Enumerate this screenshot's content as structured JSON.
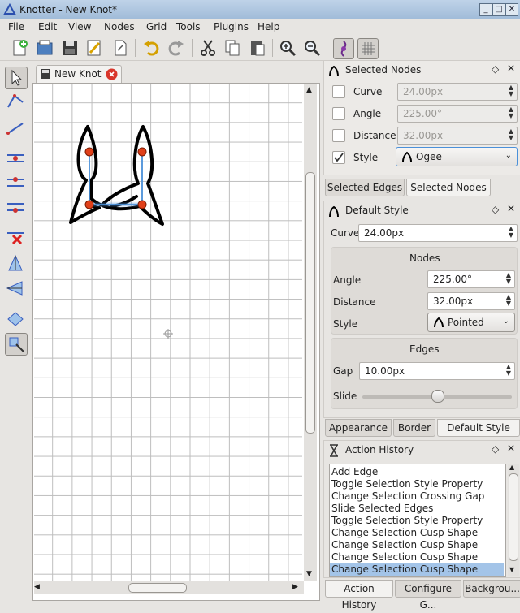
{
  "window": {
    "title": "Knotter - New Knot*"
  },
  "menu": [
    "File",
    "Edit",
    "View",
    "Nodes",
    "Grid",
    "Tools",
    "Plugins",
    "Help"
  ],
  "toolbar_icons": [
    "new-file-icon",
    "open-icon",
    "save-icon",
    "edit-icon",
    "export-icon",
    "undo-icon",
    "redo-icon",
    "cut-icon",
    "copy-icon",
    "paste-icon",
    "zoom-in-icon",
    "zoom-out-icon",
    "knot-view-icon",
    "grid-icon"
  ],
  "left_tools": [
    "select-pointer-icon",
    "edge-chain-icon",
    "edge-line-icon",
    "insert-edge-node-icon",
    "insert-node-icon",
    "link-nodes-icon",
    "delete-icon",
    "flip-vertical-icon",
    "flip-horizontal-icon",
    "merge-icon",
    "scale-icon"
  ],
  "document_tab": {
    "label": "New Knot"
  },
  "selected_nodes": {
    "title": "Selected Nodes",
    "rows": [
      {
        "label": "Curve",
        "value": "24.00px",
        "checked": false
      },
      {
        "label": "Angle",
        "value": "225.00°",
        "checked": false
      },
      {
        "label": "Distance",
        "value": "32.00px",
        "checked": false
      },
      {
        "label": "Style",
        "value": "Ogee",
        "checked": true
      }
    ]
  },
  "edge_tabs": [
    "Selected Edges",
    "Selected Nodes"
  ],
  "default_style": {
    "title": "Default Style",
    "curve_label": "Curve",
    "curve_value": "24.00px",
    "nodes_group": "Nodes",
    "angle_label": "Angle",
    "angle_value": "225.00°",
    "distance_label": "Distance",
    "distance_value": "32.00px",
    "style_label": "Style",
    "style_value": "Pointed",
    "edges_group": "Edges",
    "gap_label": "Gap",
    "gap_value": "10.00px",
    "slide_label": "Slide",
    "slide_fraction": 0.5
  },
  "style_tabs": [
    "Appearance",
    "Border",
    "Default Style"
  ],
  "action_history": {
    "title": "Action History",
    "items": [
      "Add Edge",
      "Toggle Selection Style Property",
      "Change Selection Crossing Gap",
      "Slide Selected Edges",
      "Toggle Selection Style Property",
      "Change Selection Cusp Shape",
      "Change Selection Cusp Shape",
      "Change Selection Cusp Shape",
      "Change Selection Cusp Shape"
    ],
    "selected_index": 8
  },
  "bottom_tabs": [
    "Action History",
    "Configure G...",
    "Backgrou..."
  ],
  "colors": {
    "node": "#e0401a",
    "node_link": "#4a90d9",
    "selection": "#a3c4e8"
  }
}
